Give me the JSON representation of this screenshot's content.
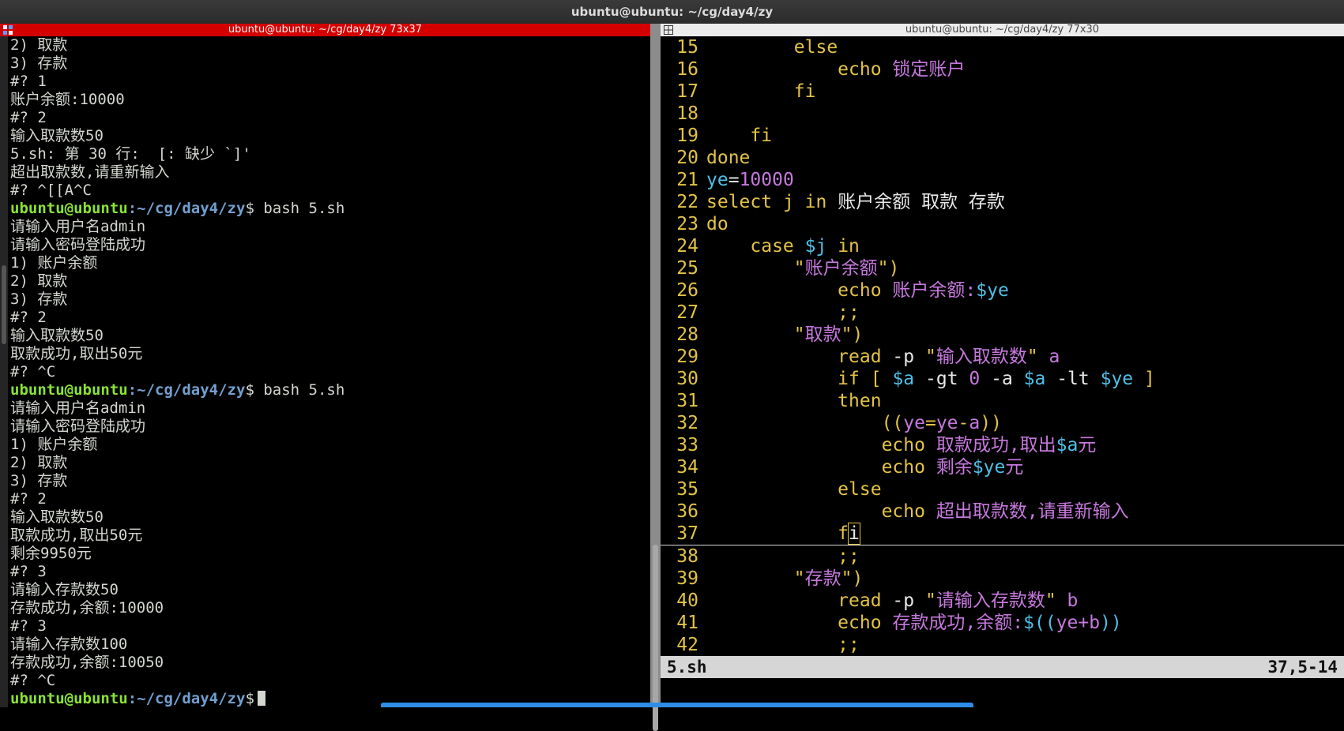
{
  "window": {
    "title": "ubuntu@ubuntu: ~/cg/day4/zy"
  },
  "left_pane": {
    "header": "ubuntu@ubuntu: ~/cg/day4/zy 73x37",
    "lines": [
      {
        "text": "2) 取款"
      },
      {
        "text": "3) 存款"
      },
      {
        "text": "#? 1"
      },
      {
        "text": "账户余额:10000"
      },
      {
        "text": "#? 2"
      },
      {
        "text": "输入取款数50"
      },
      {
        "text": "5.sh: 第 30 行:  [: 缺少 `]'"
      },
      {
        "text": "超出取款数,请重新输入"
      },
      {
        "text": "#? ^[[A^C"
      },
      {
        "user": "ubuntu@ubuntu",
        "path": ":~/cg/day4/zy",
        "text": "$ bash 5.sh"
      },
      {
        "text": "请输入用户名admin"
      },
      {
        "text": "请输入密码登陆成功"
      },
      {
        "text": "1) 账户余额"
      },
      {
        "text": "2) 取款"
      },
      {
        "text": "3) 存款"
      },
      {
        "text": "#? 2"
      },
      {
        "text": "输入取款数50"
      },
      {
        "text": "取款成功,取出50元"
      },
      {
        "text": "#? ^C"
      },
      {
        "user": "ubuntu@ubuntu",
        "path": ":~/cg/day4/zy",
        "text": "$ bash 5.sh"
      },
      {
        "text": "请输入用户名admin"
      },
      {
        "text": "请输入密码登陆成功"
      },
      {
        "text": "1) 账户余额"
      },
      {
        "text": "2) 取款"
      },
      {
        "text": "3) 存款"
      },
      {
        "text": "#? 2"
      },
      {
        "text": "输入取款数50"
      },
      {
        "text": "取款成功,取出50元"
      },
      {
        "text": "剩余9950元"
      },
      {
        "text": "#? 3"
      },
      {
        "text": "请输入存款数50"
      },
      {
        "text": "存款成功,余额:10000"
      },
      {
        "text": "#? 3"
      },
      {
        "text": "请输入存款数100"
      },
      {
        "text": "存款成功,余额:10050"
      },
      {
        "text": "#? ^C"
      },
      {
        "user": "ubuntu@ubuntu",
        "path": ":~/cg/day4/zy",
        "text": "$",
        "cursor": true
      }
    ]
  },
  "right_pane": {
    "header": "ubuntu@ubuntu: ~/cg/day4/zy 77x30",
    "cursor_line": "37",
    "lines": [
      {
        "n": "15",
        "segs": [
          [
            "",
            "        "
          ],
          [
            "kw",
            "else"
          ]
        ]
      },
      {
        "n": "16",
        "segs": [
          [
            "",
            "            "
          ],
          [
            "kw",
            "echo"
          ],
          [
            "",
            " "
          ],
          [
            "str",
            "锁定账户"
          ]
        ]
      },
      {
        "n": "17",
        "segs": [
          [
            "",
            "        "
          ],
          [
            "kw",
            "fi"
          ]
        ]
      },
      {
        "n": "18",
        "segs": []
      },
      {
        "n": "19",
        "segs": [
          [
            "",
            "    "
          ],
          [
            "kw",
            "fi"
          ]
        ]
      },
      {
        "n": "20",
        "segs": [
          [
            "kw",
            "done"
          ]
        ]
      },
      {
        "n": "21",
        "segs": [
          [
            "var",
            "ye"
          ],
          [
            "",
            "="
          ],
          [
            "str",
            "10000"
          ]
        ]
      },
      {
        "n": "22",
        "segs": [
          [
            "kw",
            "select"
          ],
          [
            "",
            " "
          ],
          [
            "kw",
            "j"
          ],
          [
            "",
            " "
          ],
          [
            "kw",
            "in"
          ],
          [
            "",
            " 账户余额 取款 存款"
          ]
        ]
      },
      {
        "n": "23",
        "segs": [
          [
            "kw",
            "do"
          ]
        ]
      },
      {
        "n": "24",
        "segs": [
          [
            "",
            "    "
          ],
          [
            "kw",
            "case"
          ],
          [
            "",
            " "
          ],
          [
            "var",
            "$j"
          ],
          [
            "",
            " "
          ],
          [
            "kw",
            "in"
          ]
        ]
      },
      {
        "n": "25",
        "segs": [
          [
            "",
            "        "
          ],
          [
            "kw",
            "\""
          ],
          [
            "str",
            "账户余额"
          ],
          [
            "kw",
            "\")"
          ]
        ]
      },
      {
        "n": "26",
        "segs": [
          [
            "",
            "            "
          ],
          [
            "kw",
            "echo"
          ],
          [
            "",
            " "
          ],
          [
            "str",
            "账户余额:"
          ],
          [
            "var",
            "$ye"
          ]
        ]
      },
      {
        "n": "27",
        "segs": [
          [
            "",
            "            "
          ],
          [
            "kw",
            ";;"
          ]
        ]
      },
      {
        "n": "28",
        "segs": [
          [
            "",
            "        "
          ],
          [
            "kw",
            "\""
          ],
          [
            "str",
            "取款"
          ],
          [
            "kw",
            "\")"
          ]
        ]
      },
      {
        "n": "29",
        "segs": [
          [
            "",
            "            "
          ],
          [
            "kw",
            "read"
          ],
          [
            "",
            " -p "
          ],
          [
            "kw",
            "\""
          ],
          [
            "str",
            "输入取款数"
          ],
          [
            "kw",
            "\""
          ],
          [
            "",
            " "
          ],
          [
            "str",
            "a"
          ]
        ]
      },
      {
        "n": "30",
        "segs": [
          [
            "",
            "            "
          ],
          [
            "kw",
            "if"
          ],
          [
            "",
            " "
          ],
          [
            "kw",
            "["
          ],
          [
            "",
            " "
          ],
          [
            "var",
            "$a"
          ],
          [
            "",
            " -gt "
          ],
          [
            "str",
            "0"
          ],
          [
            "",
            " -a "
          ],
          [
            "var",
            "$a"
          ],
          [
            "",
            " -lt "
          ],
          [
            "var",
            "$ye"
          ],
          [
            "",
            " "
          ],
          [
            "kw",
            "]"
          ]
        ]
      },
      {
        "n": "31",
        "segs": [
          [
            "",
            "            "
          ],
          [
            "kw",
            "then"
          ]
        ]
      },
      {
        "n": "32",
        "segs": [
          [
            "",
            "                "
          ],
          [
            "kw",
            "(("
          ],
          [
            "str",
            "ye"
          ],
          [
            "kw",
            "="
          ],
          [
            "str",
            "ye"
          ],
          [
            "kw",
            "-"
          ],
          [
            "str",
            "a"
          ],
          [
            "kw",
            "))"
          ]
        ]
      },
      {
        "n": "33",
        "segs": [
          [
            "",
            "                "
          ],
          [
            "kw",
            "echo"
          ],
          [
            "",
            " "
          ],
          [
            "str",
            "取款成功,取出"
          ],
          [
            "var",
            "$a"
          ],
          [
            "str",
            "元"
          ]
        ]
      },
      {
        "n": "34",
        "segs": [
          [
            "",
            "                "
          ],
          [
            "kw",
            "echo"
          ],
          [
            "",
            " "
          ],
          [
            "str",
            "剩余"
          ],
          [
            "var",
            "$ye"
          ],
          [
            "str",
            "元"
          ]
        ]
      },
      {
        "n": "35",
        "segs": [
          [
            "",
            "            "
          ],
          [
            "kw",
            "else"
          ]
        ]
      },
      {
        "n": "36",
        "segs": [
          [
            "",
            "                "
          ],
          [
            "kw",
            "echo"
          ],
          [
            "",
            " "
          ],
          [
            "str",
            "超出取款数,请重新输入"
          ]
        ]
      },
      {
        "n": "37",
        "segs": [
          [
            "",
            "            "
          ],
          [
            "kw",
            "f"
          ],
          [
            "cur",
            "i"
          ]
        ]
      },
      {
        "n": "38",
        "segs": [
          [
            "",
            "            "
          ],
          [
            "kw",
            ";;"
          ]
        ]
      },
      {
        "n": "39",
        "segs": [
          [
            "",
            "        "
          ],
          [
            "kw",
            "\""
          ],
          [
            "str",
            "存款"
          ],
          [
            "kw",
            "\")"
          ]
        ]
      },
      {
        "n": "40",
        "segs": [
          [
            "",
            "            "
          ],
          [
            "kw",
            "read"
          ],
          [
            "",
            " -p "
          ],
          [
            "kw",
            "\""
          ],
          [
            "str",
            "请输入存款数"
          ],
          [
            "kw",
            "\""
          ],
          [
            "",
            " "
          ],
          [
            "str",
            "b"
          ]
        ]
      },
      {
        "n": "41",
        "segs": [
          [
            "",
            "            "
          ],
          [
            "kw",
            "echo"
          ],
          [
            "",
            " "
          ],
          [
            "str",
            "存款成功,余额:"
          ],
          [
            "var",
            "$(("
          ],
          [
            "str",
            "ye+b"
          ],
          [
            "var",
            "))"
          ]
        ]
      },
      {
        "n": "42",
        "segs": [
          [
            "",
            "            "
          ],
          [
            "kw",
            ";;"
          ]
        ]
      }
    ],
    "status_file": "5.sh",
    "status_pos": "37,5-14"
  }
}
